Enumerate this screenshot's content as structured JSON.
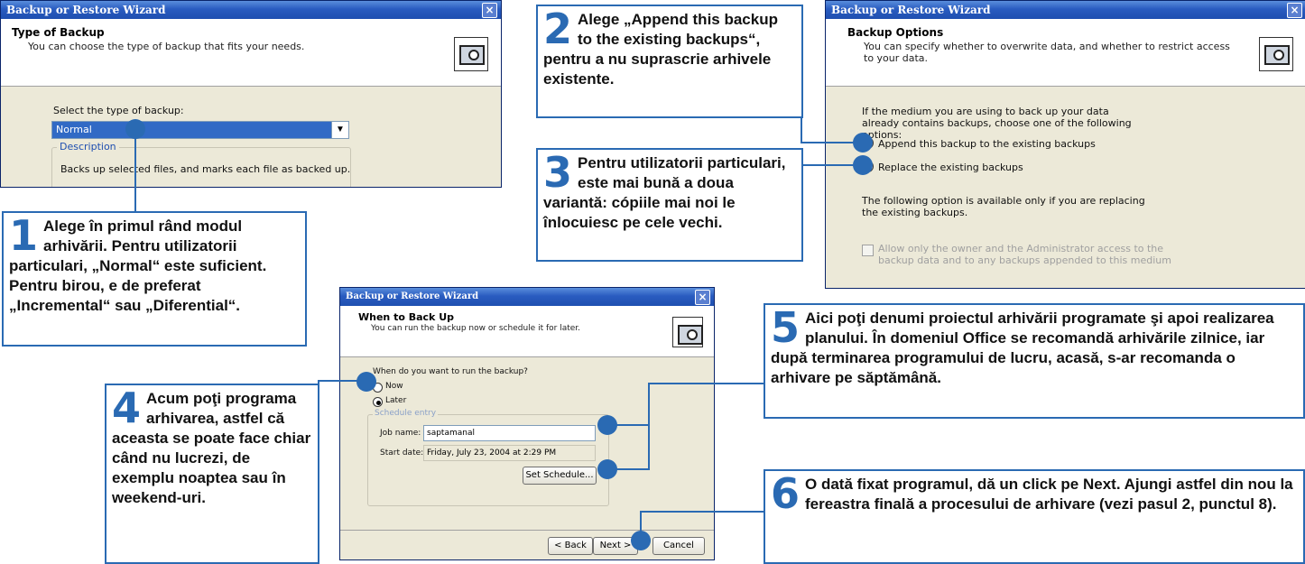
{
  "dialog1": {
    "title": "Backup or Restore Wizard",
    "close": "×",
    "header_title": "Type of Backup",
    "header_sub": "You can choose the type of backup that fits your needs.",
    "select_label": "Select the type of backup:",
    "select_value": "Normal",
    "desc_legend": "Description",
    "desc_text": "Backs up selected files, and marks each file as backed up."
  },
  "dialog2": {
    "title": "Backup or Restore Wizard",
    "close": "×",
    "header_title": "Backup Options",
    "header_sub": "You can specify whether to overwrite data, and whether to restrict access to your data.",
    "intro": "If the medium you are using to back up your data already contains backups, choose one of the following options:",
    "opt_append": "Append this backup to the existing backups",
    "opt_replace": "Replace the existing backups",
    "note": "The following option is available only if you are replacing the existing backups.",
    "checkbox": "Allow only the owner and the Administrator access to the backup data and to any backups appended to this medium"
  },
  "dialog3": {
    "title": "Backup or Restore Wizard",
    "close": "×",
    "header_title": "When to Back Up",
    "header_sub": "You can run the backup now or schedule it for later.",
    "question": "When do you want to run the backup?",
    "opt_now": "Now",
    "opt_later": "Later",
    "group_legend": "Schedule entry",
    "job_label": "Job name:",
    "job_value": "saptamanal",
    "start_label": "Start date:",
    "start_value": "Friday, July 23, 2004 at 2:29 PM",
    "set_schedule": "Set Schedule...",
    "back": "< Back",
    "next": "Next >",
    "cancel": "Cancel"
  },
  "steps": {
    "s1_num": "1",
    "s1_text": "Alege în primul rând modul arhivării. Pentru utilizatorii particulari, „Normal“ este suficient. Pentru birou, e de preferat „Incremental“ sau „Diferential“.",
    "s2_num": "2",
    "s2_text": "Alege „Append this backup to the existing backups“, pentru a nu suprascrie arhivele existente.",
    "s3_num": "3",
    "s3_text": "Pentru utilizatorii particulari, este mai bună a doua variantă: cópiile mai noi le înlocuiesc pe cele vechi.",
    "s4_num": "4",
    "s4_text": "Acum poţi programa arhivarea, astfel că aceasta se poate face chiar când nu lucrezi, de exemplu noaptea sau în weekend-uri.",
    "s5_num": "5",
    "s5_text": "Aici poţi denumi proiectul arhivării programate şi apoi realizarea planului. În domeniul Office se recomandă arhivările zilnice, iar după terminarea programului de lucru, acasă, s-ar recomanda o arhivare pe săptămână.",
    "s6_num": "6",
    "s6_text": "O dată fixat programul, dă un click pe Next. Ajungi astfel din nou la fereastra finală a procesului de arhivare (vezi pasul 2, punctul 8)."
  },
  "colors": {
    "accent": "#2a6ab3",
    "xp_title": "#2a5cc0",
    "dialog_bg": "#ece9d8"
  }
}
